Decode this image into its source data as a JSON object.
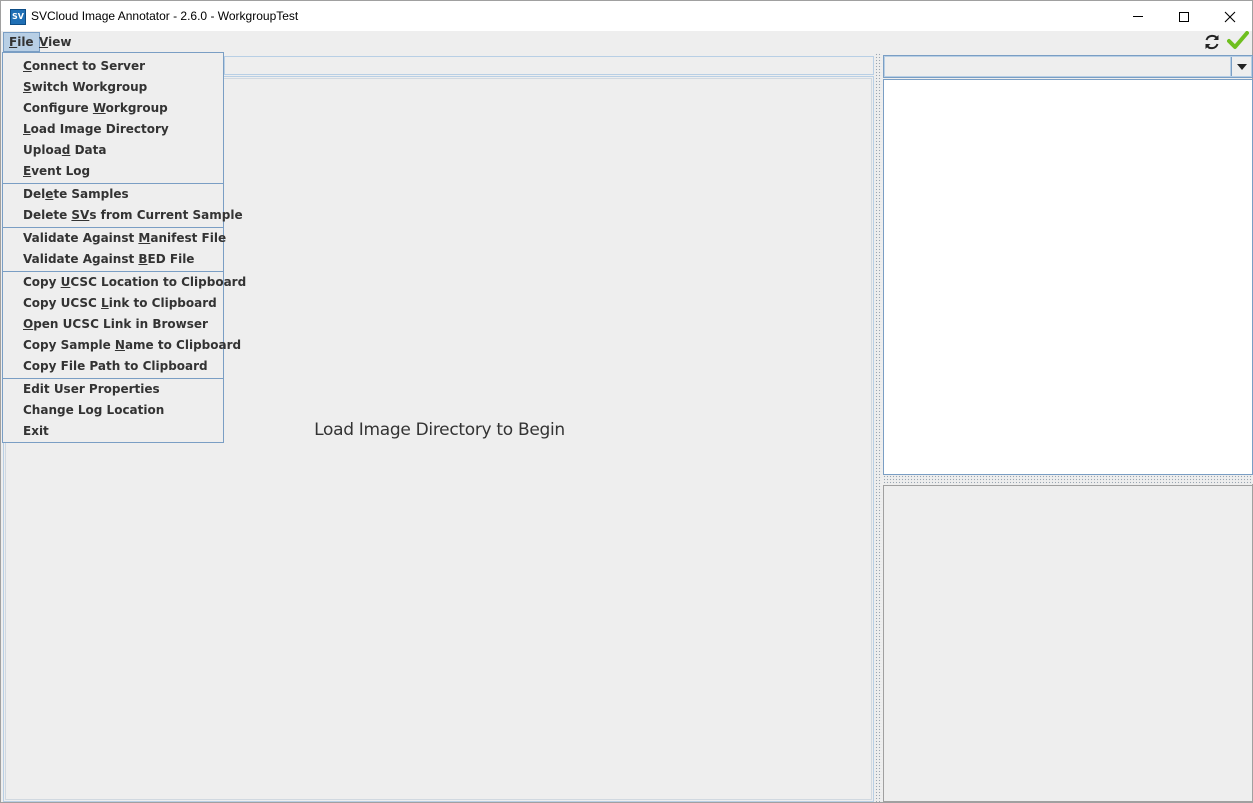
{
  "window": {
    "title": "SVCloud Image Annotator - 2.6.0 - WorkgroupTest",
    "icon_text": "SV"
  },
  "menubar": {
    "file": {
      "before": "",
      "mnemonic": "F",
      "after": "ile"
    },
    "view": {
      "before": "",
      "mnemonic": "V",
      "after": "iew"
    },
    "status_icons": [
      "refresh-icon",
      "check-icon"
    ],
    "check_color": "#6fbf1f"
  },
  "file_menu": {
    "groups": [
      [
        {
          "before": "",
          "mnemonic": "C",
          "after": "onnect to Server"
        },
        {
          "before": "",
          "mnemonic": "S",
          "after": "witch Workgroup"
        },
        {
          "before": "Configure ",
          "mnemonic": "W",
          "after": "orkgroup"
        },
        {
          "before": "",
          "mnemonic": "L",
          "after": "oad Image Directory"
        },
        {
          "before": "Uploa",
          "mnemonic": "d",
          "after": " Data"
        },
        {
          "before": "",
          "mnemonic": "E",
          "after": "vent Log"
        }
      ],
      [
        {
          "before": "Del",
          "mnemonic": "e",
          "after": "te Samples"
        },
        {
          "before": "Delete ",
          "mnemonic": "SV",
          "after": "s from Current Sample"
        }
      ],
      [
        {
          "before": "Validate Against ",
          "mnemonic": "M",
          "after": "anifest File"
        },
        {
          "before": "Validate Against ",
          "mnemonic": "B",
          "after": "ED File"
        }
      ],
      [
        {
          "before": "Copy ",
          "mnemonic": "U",
          "after": "CSC Location to Clipboard"
        },
        {
          "before": "Copy UCSC ",
          "mnemonic": "L",
          "after": "ink to Clipboard"
        },
        {
          "before": "",
          "mnemonic": "O",
          "after": "pen UCSC Link in Browser"
        },
        {
          "before": "Copy Sample ",
          "mnemonic": "N",
          "after": "ame to Clipboard"
        },
        {
          "before": "Copy File Path to Clipboard",
          "mnemonic": "",
          "after": ""
        }
      ],
      [
        {
          "before": "Edit User Properties",
          "mnemonic": "",
          "after": ""
        },
        {
          "before": "Change Log Location",
          "mnemonic": "",
          "after": ""
        },
        {
          "before": "Exit",
          "mnemonic": "",
          "after": ""
        }
      ]
    ]
  },
  "main": {
    "placeholder": "Load Image Directory to Begin"
  },
  "colors": {
    "menu_highlight": "#b8cfe5",
    "menu_border": "#7a9ec4",
    "app_icon": "#1f6fb5"
  }
}
